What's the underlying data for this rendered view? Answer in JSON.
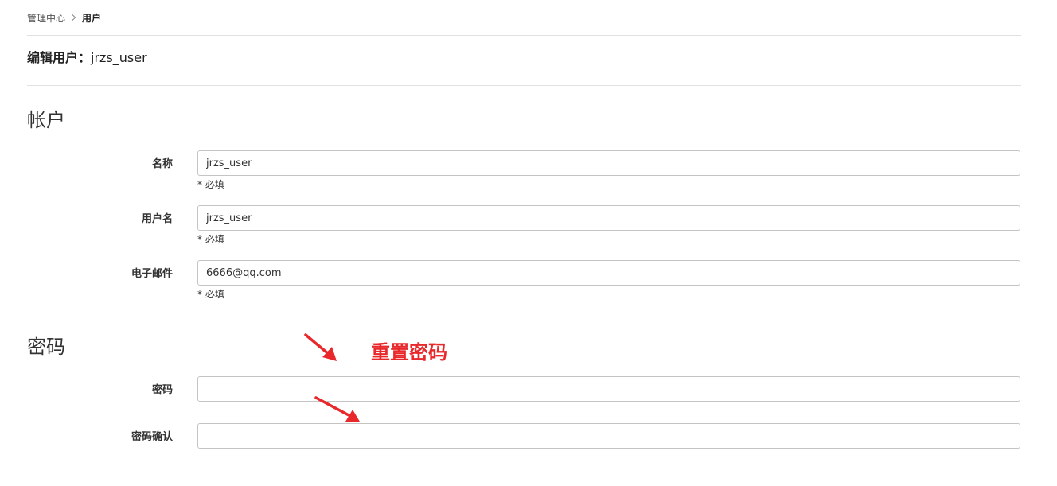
{
  "breadcrumb": {
    "parent": "管理中心",
    "current": "用户"
  },
  "page": {
    "title_prefix": "编辑用户：",
    "title_value": "jrzs_user"
  },
  "account_section": {
    "title": "帐户",
    "fields": [
      {
        "label": "名称",
        "value": "jrzs_user",
        "hint": "* 必填"
      },
      {
        "label": "用户名",
        "value": "jrzs_user",
        "hint": "* 必填"
      },
      {
        "label": "电子邮件",
        "value": "6666@qq.com",
        "hint": "* 必填"
      }
    ]
  },
  "password_section": {
    "title": "密码",
    "fields": [
      {
        "label": "密码",
        "value": ""
      },
      {
        "label": "密码确认",
        "value": ""
      }
    ]
  },
  "annotation": {
    "text": "重置密码",
    "color": "#e8282b"
  },
  "icons": {
    "breadcrumb_separator": "chevron-right-icon",
    "annotation_arrows": "arrow-icon"
  }
}
